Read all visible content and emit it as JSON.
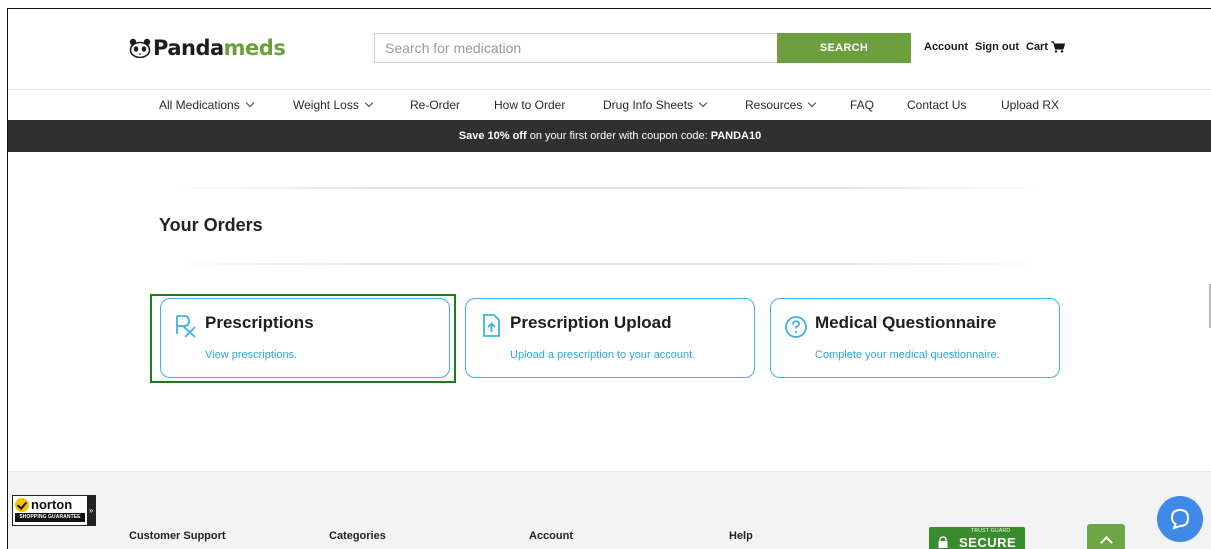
{
  "header": {
    "logo_text_a": "Panda",
    "logo_text_b": "meds",
    "search_placeholder": "Search for medication",
    "search_button": "SEARCH",
    "account_label": "Account",
    "signout_label": "Sign out",
    "cart_label": "Cart"
  },
  "nav": {
    "items": [
      {
        "label": "All Medications",
        "has_dropdown": true
      },
      {
        "label": "Weight Loss",
        "has_dropdown": true
      },
      {
        "label": "Re-Order",
        "has_dropdown": false
      },
      {
        "label": "How to Order",
        "has_dropdown": false
      },
      {
        "label": "Drug Info Sheets",
        "has_dropdown": true
      },
      {
        "label": "Resources",
        "has_dropdown": true
      },
      {
        "label": "FAQ",
        "has_dropdown": false
      },
      {
        "label": "Contact Us",
        "has_dropdown": false
      },
      {
        "label": "Upload RX",
        "has_dropdown": false
      }
    ]
  },
  "promo": {
    "lead": "Save 10% off",
    "middle": " on your first order with coupon code: ",
    "code": "PANDA10"
  },
  "main": {
    "section_title": "Your Orders",
    "cards": [
      {
        "title": "Prescriptions",
        "link": "View prescriptions.",
        "icon": "rx-icon"
      },
      {
        "title": "Prescription Upload",
        "link": "Upload a prescription to your account.",
        "icon": "file-upload-icon"
      },
      {
        "title": "Medical Questionnaire",
        "link": "Complete your medical questionnaire.",
        "icon": "question-circle-icon"
      }
    ]
  },
  "footer": {
    "columns": [
      "Customer Support",
      "Categories",
      "Account",
      "Help"
    ],
    "norton_brand": "norton",
    "norton_sub": "SHOPPING GUARANTEE",
    "trust_small": "TRUST GUARD",
    "trust_big": "SECURE"
  },
  "colors": {
    "brand_green": "#6e9f3f",
    "accent_blue": "#3db3e3",
    "link_blue": "#2ea7dc",
    "promo_bg": "#303030",
    "highlight_green": "#1d7c1d"
  }
}
